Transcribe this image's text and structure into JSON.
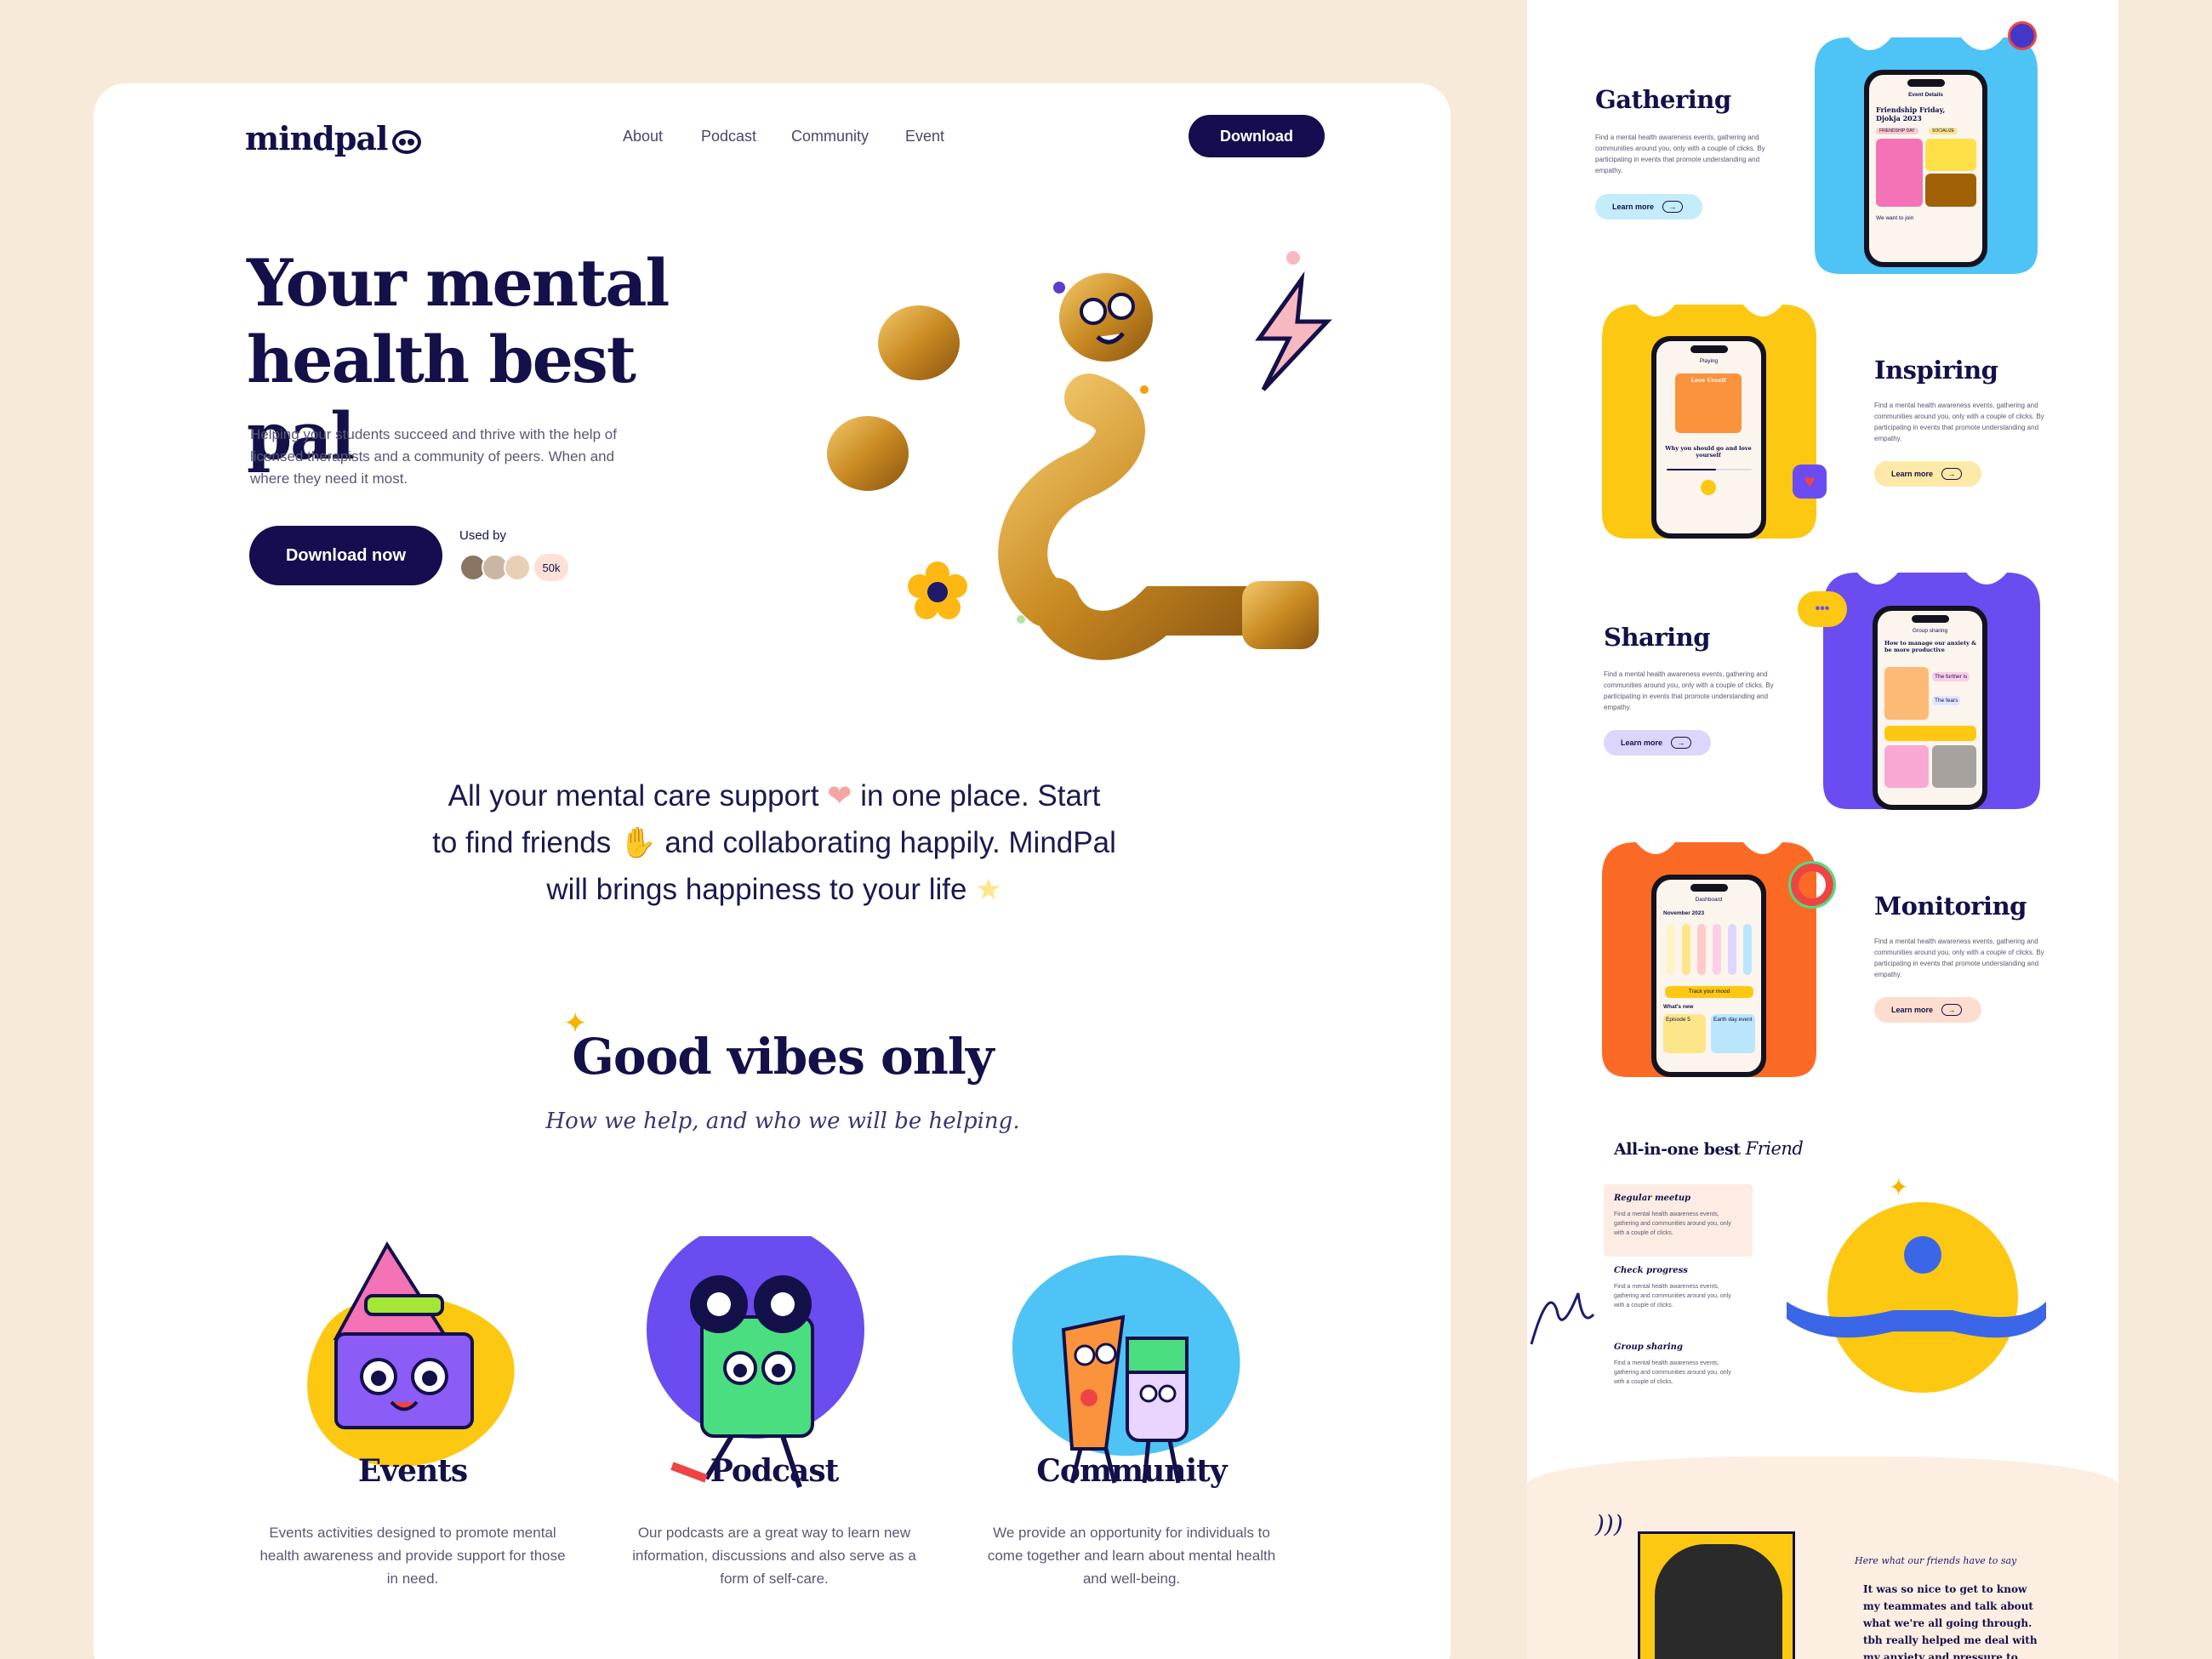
{
  "header": {
    "logo": "mindpal",
    "nav": [
      "About",
      "Podcast",
      "Community",
      "Event"
    ],
    "download_label": "Download"
  },
  "hero": {
    "title_line1": "Your mental",
    "title_line2": "health best pal",
    "description": "Helping your students succeed and thrive with the help of licensed therapists and a community of peers. When and where they need it most.",
    "cta_label": "Download now",
    "used_by_label": "Used by",
    "used_by_count": "50k"
  },
  "statement": {
    "line1a": "All your mental care support",
    "line1b": "in one place. Start",
    "line2a": "to find friends",
    "line2b": "and collaborating happily. MindPal",
    "line3": "will brings happiness to your life"
  },
  "good_vibes": {
    "title": "Good vibes only",
    "subtitle": "How we help, and who we will be helping."
  },
  "features": [
    {
      "title": "Events",
      "description": "Events activities designed to promote mental health awareness and provide support for those in need."
    },
    {
      "title": "Podcast",
      "description": "Our podcasts are a great way to learn new information, discussions and  also serve as a form of self-care."
    },
    {
      "title": "Community",
      "description": "We provide an opportunity for individuals to come together and learn about mental health and well-being."
    }
  ],
  "sections": [
    {
      "title": "Gathering",
      "description": "Find a mental health awareness events, gathering and communities around you, only with a couple of clicks. By participating in events that promote understanding and empathy.",
      "cta": "Learn more",
      "color": "#4ec3f5",
      "pill_color": "#c5ecfb"
    },
    {
      "title": "Inspiring",
      "description": "Find a mental health awareness events, gathering and communities around you, only with a couple of clicks. By participating in events that promote understanding and empathy.",
      "cta": "Learn more",
      "color": "#fdc812",
      "pill_color": "#fde9a8"
    },
    {
      "title": "Sharing",
      "description": "Find a mental health awareness events, gathering and communities around you, only with a couple of clicks. By participating in events that promote understanding and empathy.",
      "cta": "Learn more",
      "color": "#6b4cf0",
      "pill_color": "#ddd6fb"
    },
    {
      "title": "Monitoring",
      "description": "Find a mental health awareness events, gathering and communities around you, only with a couple of clicks. By participating in events that promote understanding and empathy.",
      "cta": "Learn more",
      "color": "#fb6a24",
      "pill_color": "#fdddd0"
    }
  ],
  "phones": {
    "gathering": {
      "header": "Event Details",
      "event_title": "Friendship Friday, Djokja 2023",
      "tag1": "FRIENDSHIP DAY",
      "tag2": "SOCIALIZE",
      "row1": "We want to join"
    },
    "inspiring": {
      "header": "Playing",
      "card_title": "Love Urself",
      "episode": "Why you should go and love yourself"
    },
    "sharing": {
      "header": "Group sharing",
      "title": "How to manage our anxiety & be more productive",
      "tag1": "The further is",
      "tag2": "The fears"
    },
    "monitoring": {
      "header": "Dashboard",
      "month": "November 2023",
      "cta": "Track your mood",
      "label": "What's new",
      "card1": "Episode 5",
      "card2": "Earth day event"
    }
  },
  "all_in_one": {
    "title": "All-in-one best",
    "title_script": "Friend",
    "items": [
      {
        "title": "Regular meetup",
        "description": "Find a mental health awareness events, gathering and communities around you, only with a couple of clicks."
      },
      {
        "title": "Check progress",
        "description": "Find a mental health awareness events, gathering and communities around you, only with a couple of clicks."
      },
      {
        "title": "Group sharing",
        "description": "Find a mental health awareness events, gathering and communities around you, only with a couple of clicks."
      }
    ]
  },
  "testimonial": {
    "label": "Here what our friends have to say",
    "quote": "It was so nice to get to know my teammates and talk about what we're all going through. tbh really helped me deal with my anxiety and pressure to please others."
  },
  "colors": {
    "navy": "#150d4f",
    "background": "#f8ead9",
    "gold": "#d89b2b",
    "pink": "#f6a5a5",
    "yellow": "#fdc812",
    "blue": "#4ec3f5",
    "purple": "#6b4cf0",
    "orange": "#fb6a24"
  }
}
